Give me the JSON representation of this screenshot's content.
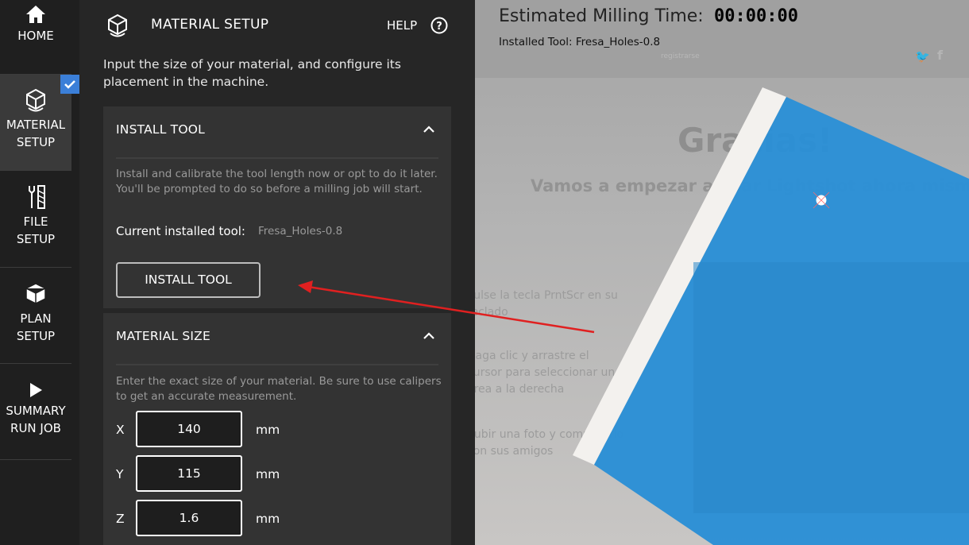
{
  "nav": {
    "home": "HOME",
    "material_setup": [
      "MATERIAL",
      "SETUP"
    ],
    "file_setup": [
      "FILE",
      "SETUP"
    ],
    "plan_setup": [
      "PLAN",
      "SETUP"
    ],
    "summary": [
      "SUMMARY",
      "RUN JOB"
    ]
  },
  "header": {
    "title": "MATERIAL SETUP",
    "help": "HELP"
  },
  "intro": "Input the size of your material, and configure its placement in the machine.",
  "install_tool": {
    "title": "INSTALL TOOL",
    "description": "Install and calibrate the tool length now or opt to do it later. You'll be prompted to do so before a milling job will start.",
    "current_label": "Current installed tool:",
    "current_value": "Fresa_Holes-0.8",
    "button": "INSTALL TOOL"
  },
  "material_size": {
    "title": "MATERIAL SIZE",
    "description": "Enter the exact size of your material. Be sure to use calipers to get an accurate measurement.",
    "dims": [
      {
        "label": "X",
        "value": "140",
        "unit": "mm"
      },
      {
        "label": "Y",
        "value": "115",
        "unit": "mm"
      },
      {
        "label": "Z",
        "value": "1.6",
        "unit": "mm"
      }
    ]
  },
  "viewport": {
    "est_label": "Estimated Milling Time:",
    "est_value": "00:00:00",
    "installed_tool": "Installed Tool: Fresa_Holes-0.8",
    "background_text": {
      "brand": "registrarse",
      "headline": "Gracias!",
      "subheadline": "Vamos a empezar a usar Lightshot ahora mismo",
      "steps": [
        "Pulse la tecla PrntScr en su teclado",
        "Haga clic y arrastre el cursor para seleccionar un área a la derecha",
        "Subir una foto y compartirlo con sus amigos"
      ]
    }
  },
  "colors": {
    "accent": "#3b7fd8",
    "material": "#2b8fd6",
    "annotation": "#e02020"
  }
}
